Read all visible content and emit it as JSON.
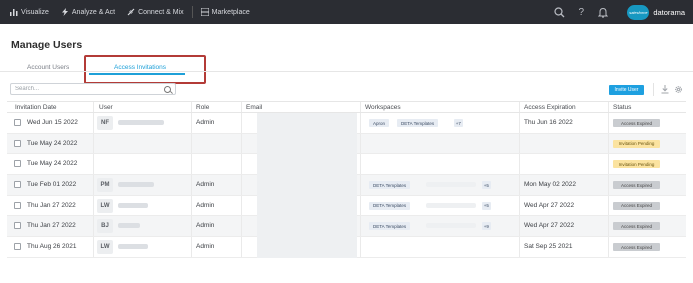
{
  "nav": {
    "items": [
      {
        "label": "Visualize"
      },
      {
        "label": "Analyze & Act"
      },
      {
        "label": "Connect & Mix"
      },
      {
        "label": "Marketplace"
      }
    ],
    "brand_logo_text": "salesforce",
    "brand_name": "datorama"
  },
  "page": {
    "title": "Manage Users",
    "tabs": [
      {
        "label": "Account Users"
      },
      {
        "label": "Access Invitations"
      }
    ],
    "active_tab": "Access Invitations"
  },
  "toolbar": {
    "search_placeholder": "Search...",
    "invite_label": "Invite User"
  },
  "table": {
    "headers": [
      "Invitation Date",
      "User",
      "Role",
      "Email",
      "Workspaces",
      "Access Expiration",
      "Status"
    ],
    "rows": [
      {
        "date": "Wed Jun 15 2022",
        "initials": "NF",
        "role": "Admin",
        "ws": [
          "Apron",
          "DETA Templates"
        ],
        "ws_more": "+7",
        "expiration": "Thu Jun 16 2022",
        "status": "Access Expired"
      },
      {
        "date": "Tue May 24 2022",
        "initials": "",
        "role": "",
        "ws": [],
        "ws_more": "",
        "expiration": "",
        "status": "Invitation Pending"
      },
      {
        "date": "Tue May 24 2022",
        "initials": "",
        "role": "",
        "ws": [],
        "ws_more": "",
        "expiration": "",
        "status": "Invitation Pending"
      },
      {
        "date": "Tue Feb 01 2022",
        "initials": "PM",
        "role": "Admin",
        "ws": [
          "DETA Templates"
        ],
        "ws_more": "+5",
        "expiration": "Mon May 02 2022",
        "status": "Access Expired"
      },
      {
        "date": "Thu Jan 27 2022",
        "initials": "LW",
        "role": "Admin",
        "ws": [
          "DETA Templates"
        ],
        "ws_more": "+5",
        "expiration": "Wed Apr 27 2022",
        "status": "Access Expired"
      },
      {
        "date": "Thu Jan 27 2022",
        "initials": "BJ",
        "role": "Admin",
        "ws": [
          "DETA Templates"
        ],
        "ws_more": "+9",
        "expiration": "Wed Apr 27 2022",
        "status": "Access Expired"
      },
      {
        "date": "Thu Aug 26 2021",
        "initials": "LW",
        "role": "Admin",
        "ws": [],
        "ws_more": "",
        "expiration": "Sat Sep 25 2021",
        "status": "Access Expired"
      }
    ]
  },
  "colors": {
    "nav_bg": "#2b2d33",
    "accent": "#1ea0d8",
    "highlight_box": "#b33b37",
    "status_expired": "#c9ccd0",
    "status_pending": "#fbe3a0"
  }
}
